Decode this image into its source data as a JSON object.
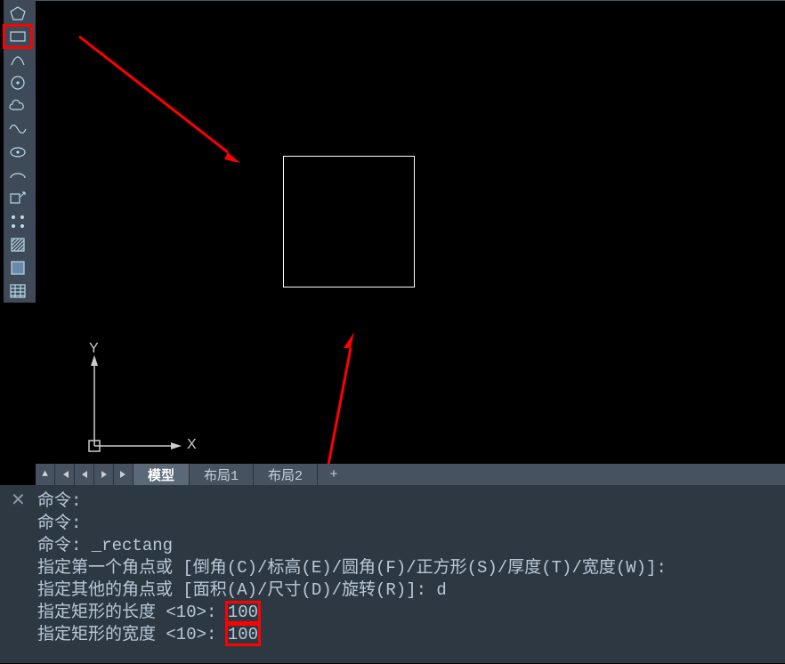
{
  "toolbar": {
    "tools": [
      {
        "name": "polygon-icon"
      },
      {
        "name": "rectangle-icon"
      },
      {
        "name": "arc-icon"
      },
      {
        "name": "circle-icon"
      },
      {
        "name": "cloud-icon"
      },
      {
        "name": "spline-icon"
      },
      {
        "name": "ellipse-icon"
      },
      {
        "name": "ellipse-arc-icon"
      },
      {
        "name": "block-insert-icon"
      },
      {
        "name": "point-icon"
      },
      {
        "name": "hatch-icon"
      },
      {
        "name": "gradient-icon"
      },
      {
        "name": "table-icon"
      }
    ],
    "highlighted_index": 1
  },
  "ucs": {
    "x_label": "X",
    "y_label": "Y"
  },
  "tabs": {
    "items": [
      {
        "label": "模型",
        "active": true
      },
      {
        "label": "布局1",
        "active": false
      },
      {
        "label": "布局2",
        "active": false
      }
    ],
    "add_label": "+"
  },
  "command": {
    "lines": [
      {
        "text": "命令:"
      },
      {
        "text": "命令:"
      },
      {
        "text": "命令: _rectang"
      },
      {
        "text": "指定第一个角点或 [倒角(C)/标高(E)/圆角(F)/正方形(S)/厚度(T)/宽度(W)]:"
      },
      {
        "text": "指定其他的角点或 [面积(A)/尺寸(D)/旋转(R)]: d"
      },
      {
        "pre": "指定矩形的长度 <10>: ",
        "hl": "100"
      },
      {
        "pre": "指定矩形的宽度 <10>: ",
        "hl": "100"
      }
    ]
  }
}
